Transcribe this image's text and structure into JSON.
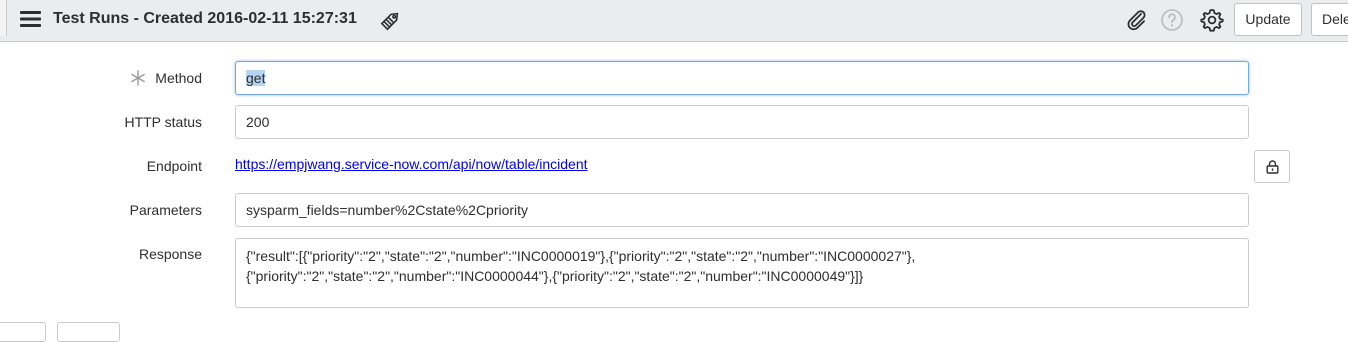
{
  "header": {
    "title": "Test Runs - Created 2016-02-11 15:27:31",
    "update_label": "Update",
    "delete_label": "Dele"
  },
  "form": {
    "method": {
      "label": "Method",
      "value": "get",
      "required": true
    },
    "http_status": {
      "label": "HTTP status",
      "value": "200"
    },
    "endpoint": {
      "label": "Endpoint",
      "value": "https://empjwang.service-now.com/api/now/table/incident"
    },
    "parameters": {
      "label": "Parameters",
      "value": "sysparm_fields=number%2Cstate%2Cpriority"
    },
    "response": {
      "label": "Response",
      "line1": "{\"result\":[{\"priority\":\"2\",\"state\":\"2\",\"number\":\"INC0000019\"},{\"priority\":\"2\",\"state\":\"2\",\"number\":\"INC0000027\"},",
      "line2": "{\"priority\":\"2\",\"state\":\"2\",\"number\":\"INC0000044\"},{\"priority\":\"2\",\"state\":\"2\",\"number\":\"INC0000049\"}]}"
    }
  },
  "colors": {
    "header_bg": "#ebecee",
    "link": "#0000ee",
    "focus": "#73a7e6",
    "selection": "#b5d3f3"
  },
  "icons": [
    "menu-icon",
    "tag-icon",
    "paperclip-icon",
    "help-icon",
    "gear-icon",
    "required-asterisk-icon",
    "lock-icon"
  ]
}
